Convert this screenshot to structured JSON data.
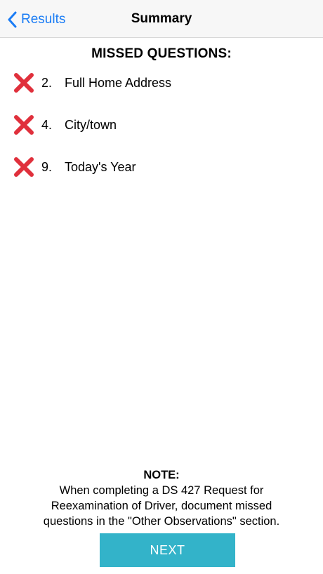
{
  "nav": {
    "back_label": "Results",
    "title": "Summary",
    "back_icon": "chevron-left-icon"
  },
  "main": {
    "heading": "MISSED QUESTIONS:",
    "status_icon": "cross-mark-icon",
    "items": [
      {
        "number": "2.",
        "label": "Full Home Address"
      },
      {
        "number": "4.",
        "label": "City/town"
      },
      {
        "number": "9.",
        "label": "Today's Year"
      }
    ]
  },
  "note": {
    "title": "NOTE:",
    "lines": [
      "When completing a DS 427 Request for",
      "Reexamination of Driver, document missed",
      "questions in the \"Other Observations\" section."
    ]
  },
  "footer": {
    "next_label": "NEXT"
  },
  "colors": {
    "accent": "#1a7cf5",
    "error": "#e0303c",
    "button": "#33b3c9"
  }
}
